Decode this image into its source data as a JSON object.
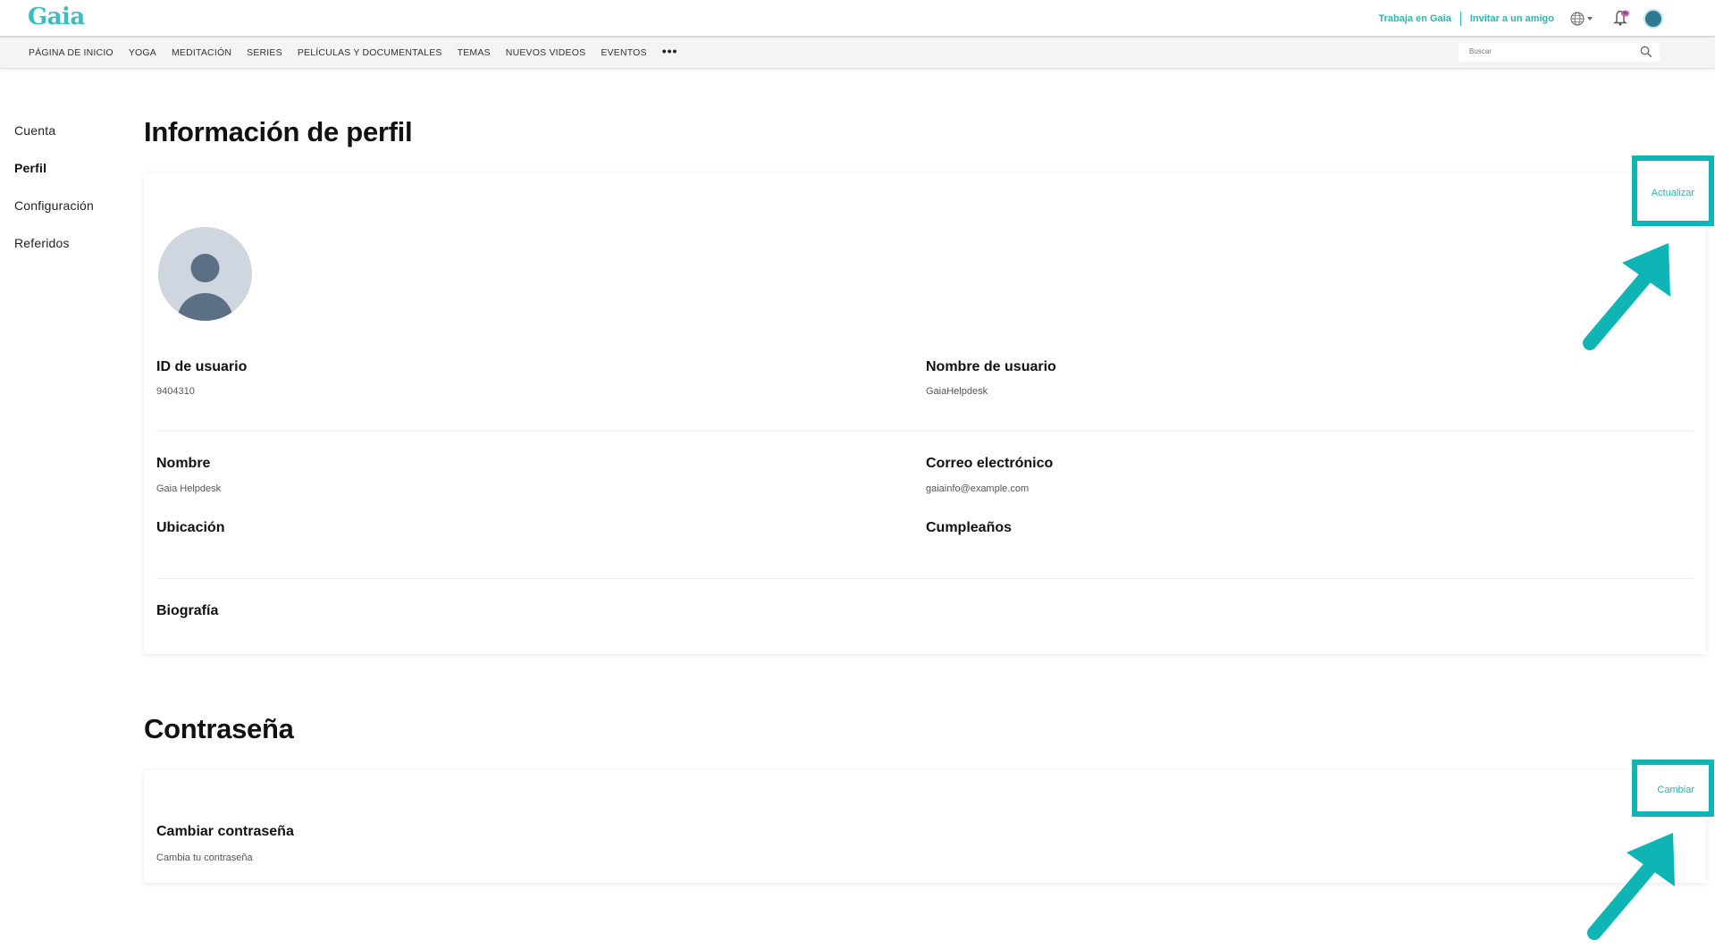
{
  "header": {
    "logo": "Gaia",
    "links": [
      "Trabaja en Gaia",
      "Invitar a un amigo"
    ],
    "icons": [
      "globe-icon",
      "bell-icon",
      "user-avatar"
    ]
  },
  "nav": {
    "items": [
      "PÁGINA DE INICIO",
      "YOGA",
      "MEDITACIÓN",
      "SERIES",
      "PELÍCULAS Y DOCUMENTALES",
      "TEMAS",
      "NUEVOS VIDEOS",
      "EVENTOS"
    ],
    "more": "•••",
    "search_placeholder": "Buscar"
  },
  "sidebar": {
    "items": [
      {
        "label": "Cuenta",
        "active": false
      },
      {
        "label": "Perfil",
        "active": true
      },
      {
        "label": "Configuración",
        "active": false
      },
      {
        "label": "Referidos",
        "active": false
      }
    ]
  },
  "profile": {
    "title": "Información de perfil",
    "update_label": "Actualizar",
    "fields": {
      "user_id_label": "ID de usuario",
      "user_id_value": "9404310",
      "username_label": "Nombre de usuario",
      "username_value": "GaiaHelpdesk",
      "name_label": "Nombre",
      "name_value": "Gaia Helpdesk",
      "email_label": "Correo electrónico",
      "email_value": "gaiainfo@example.com",
      "location_label": "Ubicación",
      "birthday_label": "Cumpleaños",
      "bio_label": "Biografía"
    }
  },
  "password": {
    "title": "Contraseña",
    "change_label": "Cambiar",
    "change_password_label": "Cambiar contraseña",
    "change_password_desc": "Cambia tu contraseña"
  },
  "colors": {
    "accent": "#2fb3b3",
    "highlight": "#0fb4b4",
    "logo": "#3cbdbd"
  }
}
